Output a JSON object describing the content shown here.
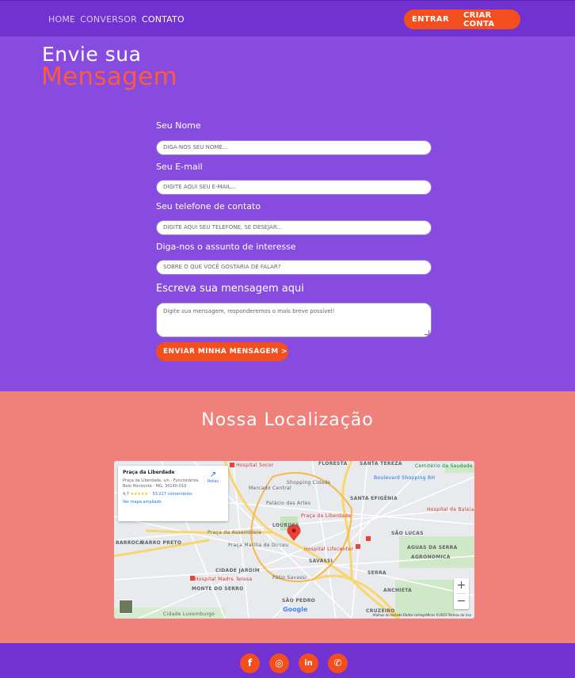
{
  "nav": {
    "links": [
      "HOME",
      "CONVERSOR",
      "CONTATO"
    ],
    "login": "ENTRAR",
    "signup": "CRIAR CONTA"
  },
  "hero": {
    "line1": "Envie sua",
    "line2": "Mensagem"
  },
  "form": {
    "name_label": "Seu Nome",
    "name_placeholder": "DIGA-NOS SEU NOME...",
    "email_label": "Seu E-mail",
    "email_placeholder": "DIGITE AQUI SEU E-MAIL...",
    "phone_label": "Seu telefone de contato",
    "phone_placeholder": "DIGITE AQUI SEU TELEFONE, SE DESEJAR...",
    "subject_label": "Diga-nos o assunto de interesse",
    "subject_placeholder": "SOBRE O QUE VOCÊ GOSTARIA DE FALAR?",
    "message_label": "Escreva sua mensagem aqui",
    "message_placeholder": "Digite sua mensagem, responderemos o mais breve possível!",
    "submit": "ENVIAR MINHA MENSAGEM >"
  },
  "location": {
    "title": "Nossa Localização",
    "place_name": "Praça da Liberdade",
    "address": "Praça da Liberdade, s/n - Funcionários, Belo Horizonte - MG, 30140-010",
    "rating": "4,7",
    "stars": "★★★★★",
    "reviews": "53.217 comentários",
    "bigger_map": "Ver mapa ampliado",
    "routes": "Rotas",
    "google": "Google",
    "attribution": "Atalhos do teclado   Dados cartográficos ©2023   Termos de Uso",
    "map_labels": {
      "floresta": "FLORESTA",
      "santa_tereza": "SANTA TEREZA",
      "santa_efigenia": "SANTA EFIGÊNIA",
      "lourdes": "LOURDES",
      "savassi": "SAVASSI",
      "serra": "SERRA",
      "cruzeiro": "CRUZEIRO",
      "sao_pedro": "SÃO PEDRO",
      "cidade_jardim": "CIDADE JARDIM",
      "barro_preto": "BARRO PRETO",
      "anchieta": "ANCHIETA",
      "sao_lucas": "SÃO LUCAS",
      "aguas_da_serra": "AGUAS DA SERRA",
      "agronomica": "AGRONOMICA",
      "hospital_socor": "Hospital Socor",
      "cemiterio": "Cemitério da Saudade",
      "hospital_lifecenter": "Hospital Lifecenter",
      "hospital_madre_teresa": "Hospital Madre Teresa",
      "praca_assembleia": "Praça da Assembleia",
      "praca_marilia": "Praça Marília de Dirceu",
      "pin_label": "Praça da Liberdade",
      "mercado_central": "Mercado Central",
      "shopping_cidade": "Shopping Cidade",
      "boulevard": "Boulevard Shopping BH",
      "palacio_artes": "Palácio das Artes",
      "hospital_baleia": "Hospital da Baleia",
      "patio_savassi": "Pátio Savassi",
      "cidade_luxemburgo": "Cidade Luxemburgo",
      "barroca": "BARROCA",
      "monte_do_serro": "MONTE DO SERRO"
    },
    "zoom_in": "+",
    "zoom_out": "−"
  },
  "social": [
    "f",
    "◎",
    "in",
    "✆"
  ],
  "colors": {
    "purple": "#874be0",
    "nav": "#7132d1",
    "accent": "#f24e1e",
    "coral": "#f0817a"
  }
}
